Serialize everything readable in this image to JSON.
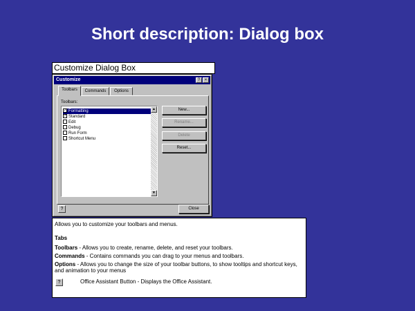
{
  "slide": {
    "title": "Short description: Dialog box"
  },
  "caption": "Customize Dialog Box",
  "dialog": {
    "title": "Customize",
    "help_glyph": "?",
    "close_glyph": "×",
    "tabs": [
      {
        "label": "Toolbars"
      },
      {
        "label": "Commands"
      },
      {
        "label": "Options"
      }
    ],
    "list_label": "Toolbars:",
    "toolbars": [
      {
        "label": "Formatting",
        "checked": "✓"
      },
      {
        "label": "Standard",
        "checked": "✓"
      },
      {
        "label": "Edit",
        "checked": ""
      },
      {
        "label": "Debug",
        "checked": ""
      },
      {
        "label": "Run Form",
        "checked": ""
      },
      {
        "label": "Shortcut Menu",
        "checked": ""
      }
    ],
    "buttons": {
      "new": "New...",
      "rename": "Rename...",
      "delete": "Delete",
      "reset": "Reset...",
      "close": "Close"
    },
    "scroll_up": "▲",
    "scroll_down": "▼",
    "assistant_glyph": "?"
  },
  "help": {
    "intro": "Allows you to customize your toolbars and menus.",
    "tabs_heading": "Tabs",
    "toolbars_term": "Toolbars",
    "toolbars_desc": " - Allows you to create, rename, delete, and reset your toolbars.",
    "commands_term": "Commands",
    "commands_desc": " - Contains commands you can drag to your menus and toolbars.",
    "options_term": "Options",
    "options_desc": " - Allows you to change the size of your toolbar buttons, to show tooltips and shortcut keys,",
    "options_desc2": "and animation to your menus",
    "assistant_label": "Office Assistant Button - Displays the Office Assistant.",
    "assistant_glyph": "?"
  }
}
